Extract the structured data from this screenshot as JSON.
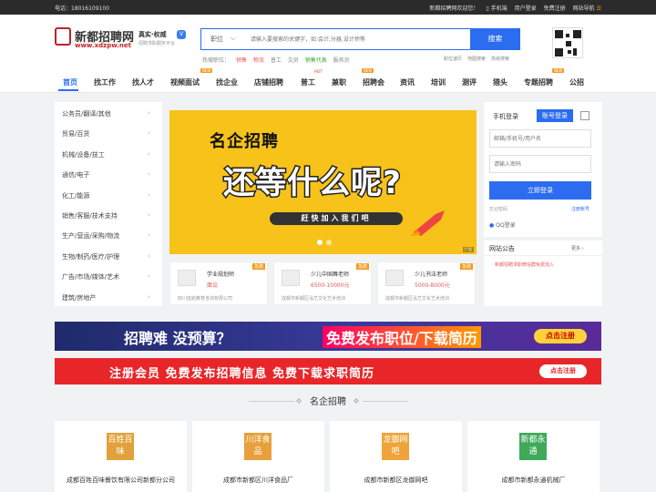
{
  "topbar": {
    "phone": "电话：18016109100",
    "welcome": "新都招聘网欢迎您！",
    "mobile": "手机端",
    "login": "用户登录",
    "register": "免费注册",
    "sitenav": "网站导航"
  },
  "header": {
    "logo_text": "新都招聘网",
    "logo_url": "www.xdzpw.net",
    "slogan": "真实·权威",
    "slogan_sub": "招聘求职服务平台",
    "badge": "V",
    "search": {
      "type_label": "职位",
      "placeholder": "请输入要搜索的关键字，如:会计,分器,设计师等",
      "button": "搜索"
    },
    "hot_label": "热搜职位：",
    "hot_items": [
      "销售",
      "物流",
      "普工",
      "文员",
      "销售代表",
      "服务员"
    ],
    "sublinks": [
      "职位速历",
      "地图搜索",
      "高级搜索"
    ]
  },
  "nav": {
    "items": [
      "首页",
      "找工作",
      "找人才",
      "视频面试",
      "找企业",
      "店铺招聘",
      "普工",
      "兼职",
      "招聘会",
      "资讯",
      "培训",
      "测评",
      "猎头",
      "专题招聘",
      "公招"
    ],
    "new_tag": "NEW",
    "hot_tag": "HOT"
  },
  "categories": [
    "公务员/翻译/其他",
    "贸易/百货",
    "机械/设备/技工",
    "通信/电子",
    "化工/能源",
    "销售/客服/技术支持",
    "生产/营运/采购/物流",
    "生物/制药/医疗/护理",
    "广告/市场/媒体/艺术",
    "建筑/房地产"
  ],
  "banner": {
    "headline": "名企招聘",
    "main": "还等什么呢?",
    "cta": "赶快加入我们吧",
    "ad": "广告"
  },
  "featured_jobs": [
    {
      "title": "学业规划师",
      "salary": "面议",
      "company": "四川蓝航教育咨询有限公司",
      "tag": "急聘"
    },
    {
      "title": "少儿中国舞老师",
      "salary": "6500-10000元",
      "company": "成都市新都区泓艺文化艺术培训",
      "tag": "急聘"
    },
    {
      "title": "少儿书法老师",
      "salary": "5000-8000元",
      "company": "成都市新都区泓艺文化艺术培训",
      "tag": "急聘"
    }
  ],
  "login": {
    "tab_mobile": "手机登录",
    "tab_account": "账号登录",
    "username_placeholder": "邮箱/手机号/用户名",
    "password_placeholder": "请输入密码",
    "submit": "立即登录",
    "forgot": "忘记密码",
    "register": "注册账号",
    "qq": "QQ登录"
  },
  "notice": {
    "title": "网站公告",
    "more": "更多",
    "items": [
      "新都招聘求职微信群免费加入"
    ]
  },
  "ad_banner1": {
    "text1": "招聘难 没预算？",
    "text2": "免费发布职位/下载简历",
    "button": "点击注册"
  },
  "ad_banner2": {
    "text1": "注册会员  免费发布招聘信息  免费下载求职简历",
    "button": "点击注册"
  },
  "section_title": "名企招聘",
  "companies": [
    {
      "logo": "百姓百味",
      "name": "成都百姓百味餐饮有限公司新都分公司",
      "color": "#e2a13a"
    },
    {
      "logo": "川洋食品",
      "name": "成都市新都区川洋食品厂",
      "color": "#e8a03c"
    },
    {
      "logo": "龙御网吧",
      "name": "成都市新都区龙御网吧",
      "color": "#f0a33a"
    },
    {
      "logo": "新都永通",
      "name": "成都市新都永通机械厂",
      "color": "#3fa95a"
    }
  ]
}
